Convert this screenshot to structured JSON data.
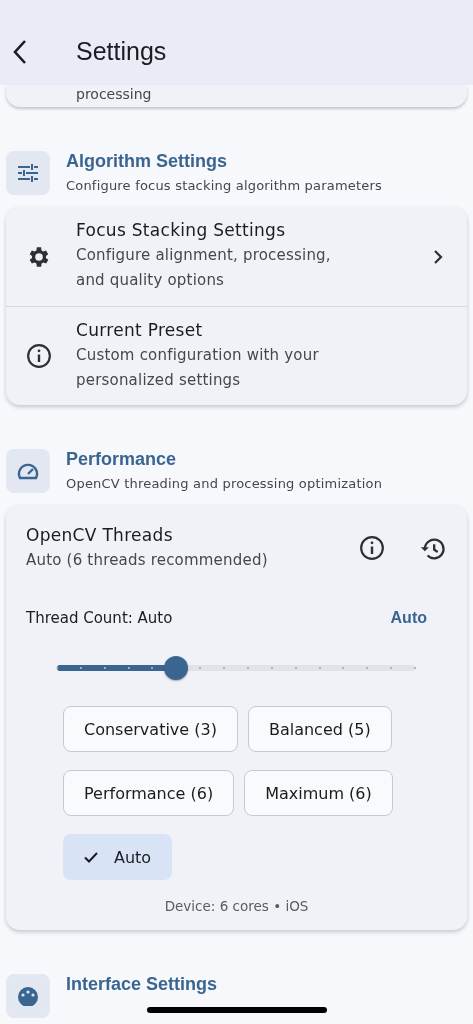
{
  "app_bar": {
    "title": "Settings"
  },
  "previous_card": {
    "text": "processing"
  },
  "sections": [
    {
      "kind": "list",
      "title": "Algorithm Settings",
      "subtitle": "Configure focus stacking algorithm parameters",
      "items": [
        {
          "title": "Focus Stacking Settings",
          "subtitle": "Configure alignment, processing, and quality options",
          "chevron": true
        },
        {
          "title": "Current Preset",
          "subtitle": "Custom configuration with your personalized settings",
          "chevron": false
        }
      ]
    },
    {
      "kind": "threads",
      "title": "Performance",
      "subtitle": "OpenCV threading and processing optimization",
      "card": {
        "title": "OpenCV Threads",
        "subtitle": "Auto (6 threads recommended)",
        "label": "Thread Count: Auto",
        "value": "Auto",
        "slider": {
          "level": 0.333
        },
        "presets": [
          {
            "label": "Conservative (3)",
            "selected": false
          },
          {
            "label": "Balanced (5)",
            "selected": false
          },
          {
            "label": "Performance (6)",
            "selected": false
          },
          {
            "label": "Maximum (6)",
            "selected": false
          },
          {
            "label": "Auto",
            "selected": true
          }
        ],
        "footer": "Device: 6 cores • iOS"
      }
    },
    {
      "kind": "header",
      "title": "Interface Settings"
    }
  ]
}
